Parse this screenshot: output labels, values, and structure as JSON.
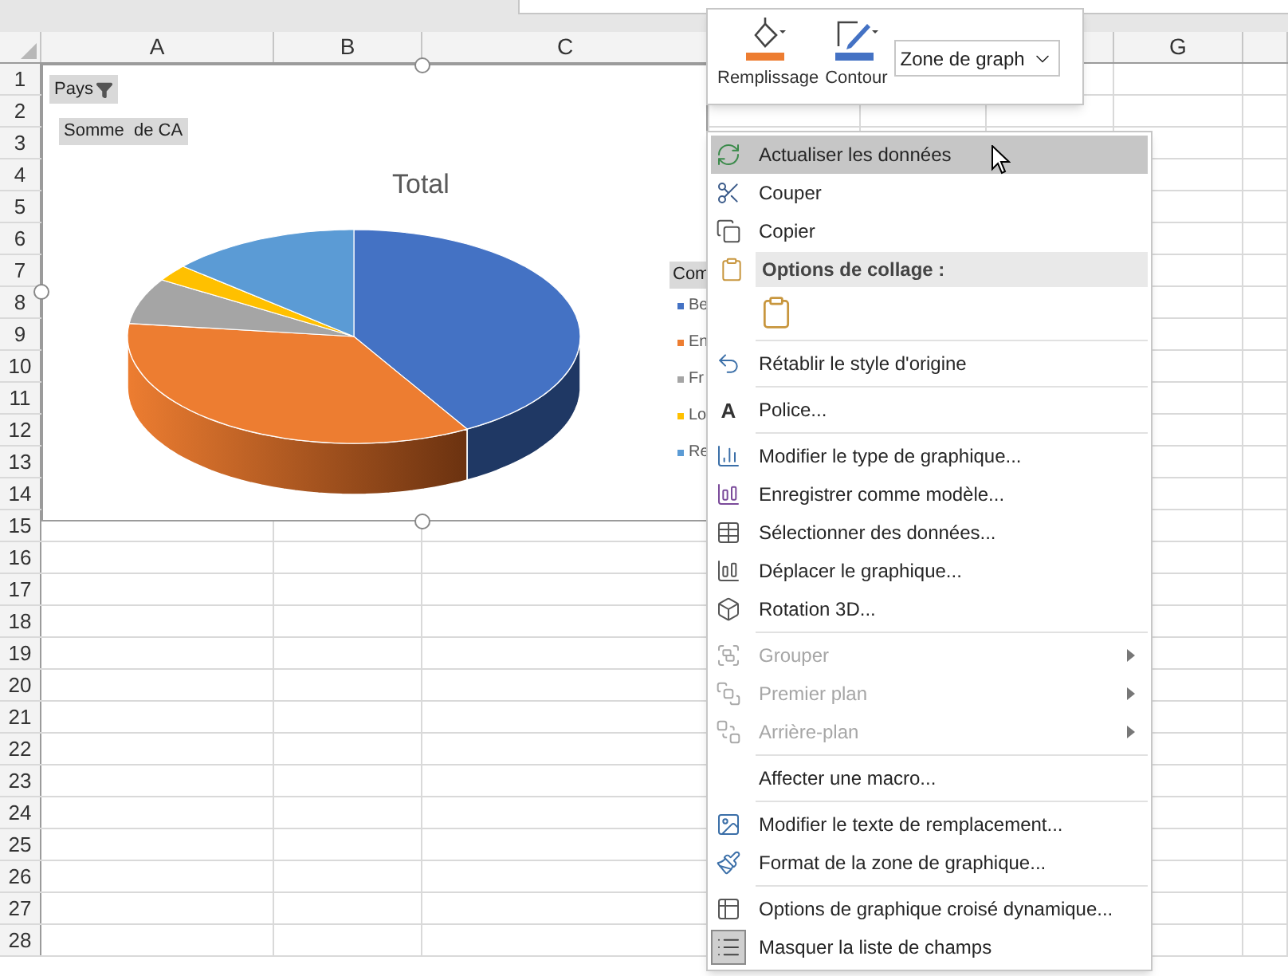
{
  "sheet": {
    "columns": [
      "A",
      "B",
      "C",
      null,
      null,
      null,
      "G",
      null
    ],
    "rows": [
      "1",
      "2",
      "3",
      "4",
      "5",
      "6",
      "7",
      "8",
      "9",
      "10",
      "11",
      "12",
      "13",
      "14",
      "15",
      "16",
      "17",
      "18",
      "19",
      "20",
      "21",
      "22",
      "23",
      "24",
      "25",
      "26",
      "27",
      "28"
    ]
  },
  "chart": {
    "filter_button": "Pays",
    "value_field": "Somme  de CA",
    "title": "Total",
    "legend": {
      "title": "Com",
      "items": [
        {
          "label": "Be",
          "color": "#4472c4"
        },
        {
          "label": "En",
          "color": "#ed7d31"
        },
        {
          "label": "Fr",
          "color": "#a5a5a5"
        },
        {
          "label": "Lo",
          "color": "#ffc000"
        },
        {
          "label": "Re",
          "color": "#5b9bd5"
        }
      ]
    }
  },
  "format_toolbar": {
    "fill_label": "Remplissage",
    "outline_label": "Contour",
    "element_select": "Zone de graph"
  },
  "context_menu": [
    {
      "kind": "item",
      "label": "Actualiser les données",
      "selected": true,
      "disabled": false,
      "submenu": false,
      "checked": false
    },
    {
      "kind": "item",
      "label": "Couper",
      "selected": false,
      "disabled": false,
      "submenu": false,
      "checked": false
    },
    {
      "kind": "item",
      "label": "Copier",
      "selected": false,
      "disabled": false,
      "submenu": false,
      "checked": false
    },
    {
      "kind": "header",
      "label": "Options de collage :"
    },
    {
      "kind": "paste"
    },
    {
      "kind": "separator"
    },
    {
      "kind": "item",
      "label": "Rétablir le style d'origine",
      "selected": false,
      "disabled": false,
      "submenu": false,
      "checked": false
    },
    {
      "kind": "separator"
    },
    {
      "kind": "item",
      "label": "Police...",
      "icon_text": "A",
      "selected": false,
      "disabled": false,
      "submenu": false,
      "checked": false
    },
    {
      "kind": "separator"
    },
    {
      "kind": "item",
      "label": "Modifier le type de graphique...",
      "selected": false,
      "disabled": false,
      "submenu": false,
      "checked": false
    },
    {
      "kind": "item",
      "label": "Enregistrer comme modèle...",
      "selected": false,
      "disabled": false,
      "submenu": false,
      "checked": false
    },
    {
      "kind": "item",
      "label": "Sélectionner des données...",
      "selected": false,
      "disabled": false,
      "submenu": false,
      "checked": false
    },
    {
      "kind": "item",
      "label": "Déplacer le graphique...",
      "selected": false,
      "disabled": false,
      "submenu": false,
      "checked": false
    },
    {
      "kind": "item",
      "label": "Rotation 3D...",
      "selected": false,
      "disabled": false,
      "submenu": false,
      "checked": false
    },
    {
      "kind": "separator"
    },
    {
      "kind": "item",
      "label": "Grouper",
      "selected": false,
      "disabled": true,
      "submenu": true,
      "checked": false
    },
    {
      "kind": "item",
      "label": "Premier plan",
      "selected": false,
      "disabled": true,
      "submenu": true,
      "checked": false
    },
    {
      "kind": "item",
      "label": "Arrière-plan",
      "selected": false,
      "disabled": true,
      "submenu": true,
      "checked": false
    },
    {
      "kind": "separator"
    },
    {
      "kind": "item",
      "label": "Affecter une macro...",
      "selected": false,
      "disabled": false,
      "submenu": false,
      "checked": false
    },
    {
      "kind": "separator"
    },
    {
      "kind": "item",
      "label": "Modifier le texte de remplacement...",
      "selected": false,
      "disabled": false,
      "submenu": false,
      "checked": false
    },
    {
      "kind": "item",
      "label": "Format de la zone de graphique...",
      "selected": false,
      "disabled": false,
      "submenu": false,
      "checked": false
    },
    {
      "kind": "separator"
    },
    {
      "kind": "item",
      "label": "Options de graphique croisé dynamique...",
      "selected": false,
      "disabled": false,
      "submenu": false,
      "checked": false
    },
    {
      "kind": "item",
      "label": "Masquer la liste de champs",
      "selected": false,
      "disabled": false,
      "submenu": false,
      "checked": true
    }
  ]
}
